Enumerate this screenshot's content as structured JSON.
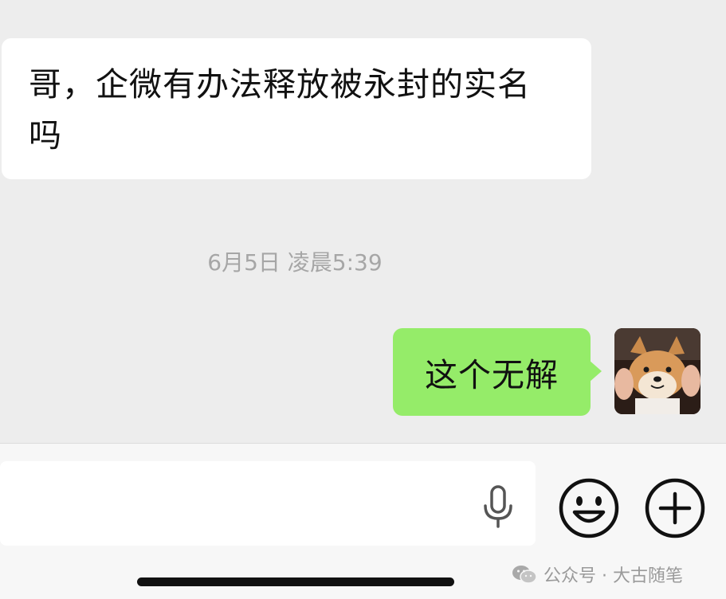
{
  "messages": {
    "incoming": {
      "line1": "哥，企微有办法释放被永封的实名",
      "line2": "吗"
    },
    "timestamp": "6月5日 凌晨5:39",
    "outgoing": {
      "text": "这个无解",
      "avatar_icon": "shiba-dog-avatar"
    }
  },
  "input_bar": {
    "input_value": "",
    "icons": [
      "microphone-icon",
      "emoji-icon",
      "plus-icon"
    ]
  },
  "watermark": {
    "icon": "wechat-icon",
    "text": "公众号 · 大古随笔"
  },
  "colors": {
    "chat_background": "#ededed",
    "incoming_bubble": "#ffffff",
    "outgoing_bubble": "#95ec69",
    "timestamp_text": "#a6a6a6"
  }
}
